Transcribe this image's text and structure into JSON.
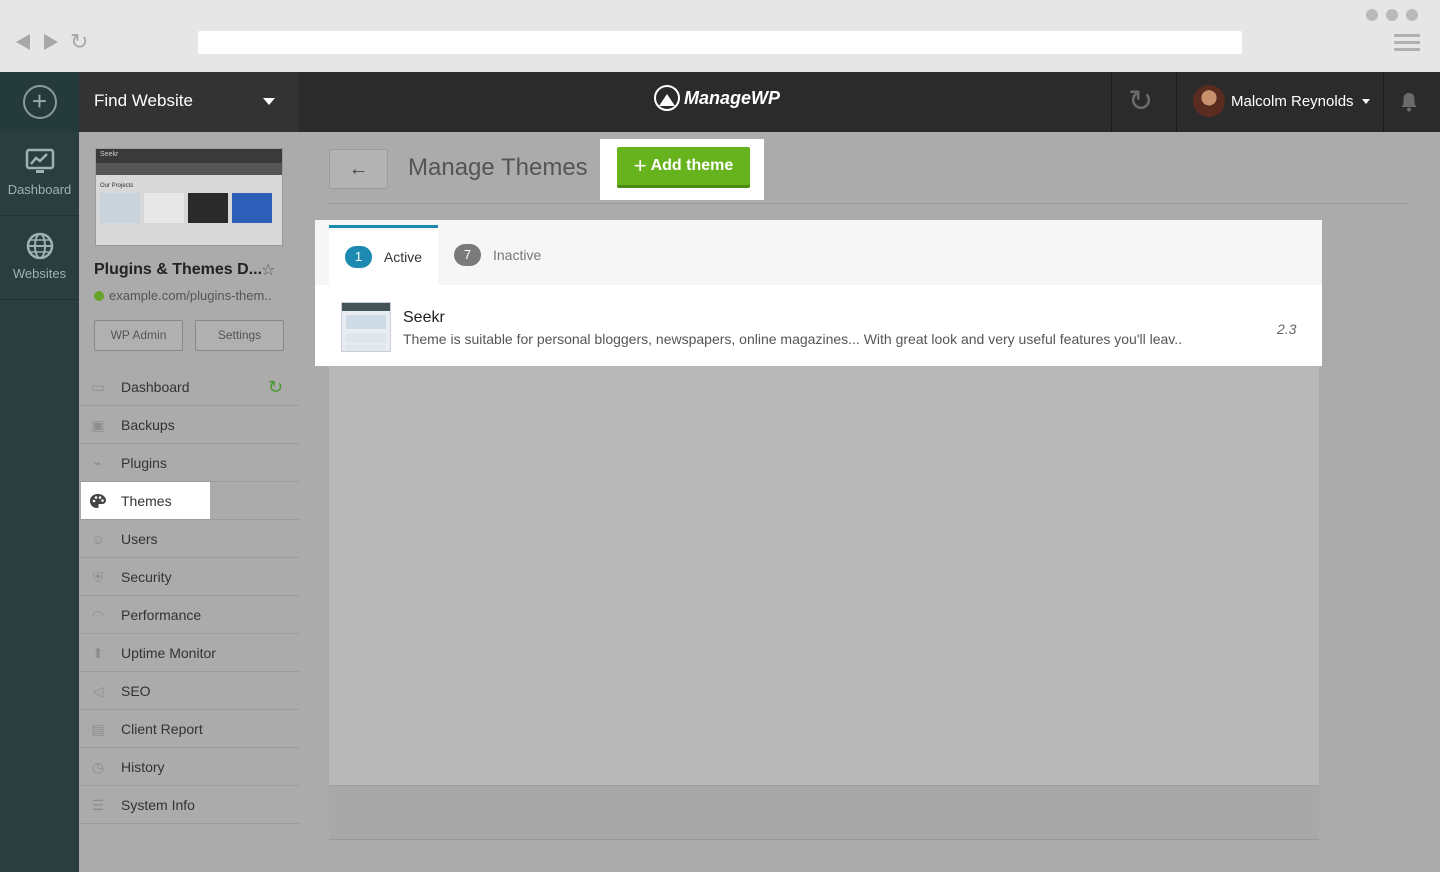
{
  "header": {
    "find_website": "Find Website",
    "logo_text": "ManageWP",
    "user_name": "Malcolm Reynolds"
  },
  "rail": {
    "items": [
      {
        "label": "Dashboard",
        "icon": "chart-monitor-icon"
      },
      {
        "label": "Websites",
        "icon": "globe-icon"
      }
    ]
  },
  "site": {
    "title": "Plugins & Themes D...",
    "url": "example.com/plugins-them..",
    "wp_admin": "WP Admin",
    "settings": "Settings",
    "thumb_brand": "Seekr",
    "thumb_label": "Our Projects"
  },
  "menu": {
    "items": [
      {
        "label": "Dashboard",
        "icon": "monitor-icon"
      },
      {
        "label": "Backups",
        "icon": "backup-icon"
      },
      {
        "label": "Plugins",
        "icon": "plug-icon"
      },
      {
        "label": "Themes",
        "icon": "palette-icon"
      },
      {
        "label": "Users",
        "icon": "user-icon"
      },
      {
        "label": "Security",
        "icon": "shield-icon"
      },
      {
        "label": "Performance",
        "icon": "gauge-icon"
      },
      {
        "label": "Uptime Monitor",
        "icon": "arrow-up-icon"
      },
      {
        "label": "SEO",
        "icon": "megaphone-icon"
      },
      {
        "label": "Client Report",
        "icon": "report-icon"
      },
      {
        "label": "History",
        "icon": "clock-icon"
      },
      {
        "label": "System Info",
        "icon": "server-icon"
      }
    ],
    "active": "Themes"
  },
  "main": {
    "title": "Manage Themes",
    "add_button": "Add theme",
    "back_symbol": "←",
    "tabs": [
      {
        "count": "1",
        "label": "Active"
      },
      {
        "count": "7",
        "label": "Inactive"
      }
    ],
    "themes": [
      {
        "name": "Seekr",
        "description": "Theme is suitable for personal bloggers, newspapers, online magazines... With great look and very useful features you'll leav..",
        "version": "2.3"
      }
    ]
  },
  "colors": {
    "accent_green": "#67b31e",
    "tab_blue": "#1c8ab1",
    "rail_bg": "#2a3e3f",
    "header_bg": "#2b2b2b"
  }
}
